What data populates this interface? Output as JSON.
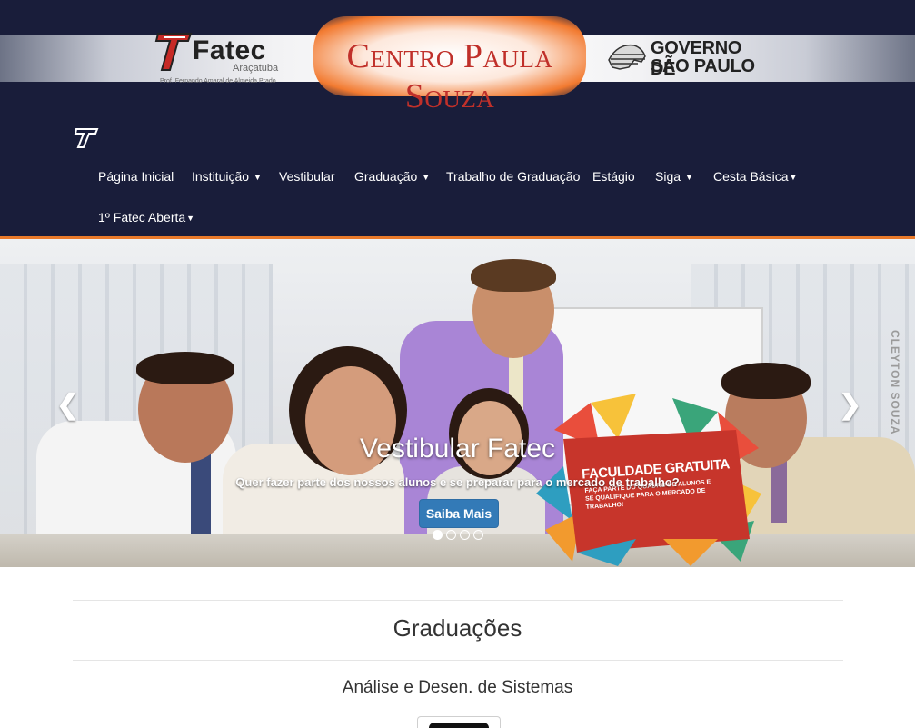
{
  "header": {
    "fatec_logo": {
      "name": "Fatec",
      "city": "Araçatuba",
      "subtitle": "Prof. Fernando Amaral de Almeida Prado"
    },
    "center_logo": "Centro Paula Souza",
    "gov_logo": {
      "line1": "GOVERNO DE",
      "line2": "SÃO PAULO"
    }
  },
  "nav": {
    "items": [
      {
        "label": "Página Inicial",
        "dropdown": false
      },
      {
        "label": "Instituição",
        "dropdown": true
      },
      {
        "label": "Vestibular",
        "dropdown": false
      },
      {
        "label": "Graduação",
        "dropdown": true
      },
      {
        "label": "Trabalho de Graduação",
        "dropdown": false
      },
      {
        "label": "Estágio",
        "dropdown": false
      },
      {
        "label": "Siga",
        "dropdown": true
      },
      {
        "label": "Cesta Básica",
        "dropdown": true
      },
      {
        "label": "1º Fatec Aberta",
        "dropdown": true
      }
    ]
  },
  "carousel": {
    "title": "Vestibular Fatec",
    "subtitle": "Quer fazer parte dos nossos alunos e se preparar para o mercado de trabalho?",
    "button_label": "Saiba Mais",
    "prev_glyph": "❮",
    "next_glyph": "❯",
    "slide_count": 4,
    "active_slide": 1,
    "image_text": {
      "headline": "FACULDADE GRATUITA",
      "body": "FAÇA PARTE DO QUADRO DE ALUNOS E SE QUALIFIQUE PARA O MERCADO DE TRABALHO!",
      "watermark": "CLEYTON SOUZA"
    }
  },
  "content": {
    "section_title": "Graduações",
    "course_title": "Análise e Desen. de Sistemas"
  },
  "colors": {
    "header_bg": "#191d3a",
    "accent_orange": "#ea7a2a",
    "button_blue": "#337ab7",
    "cps_red": "#c0302a"
  }
}
